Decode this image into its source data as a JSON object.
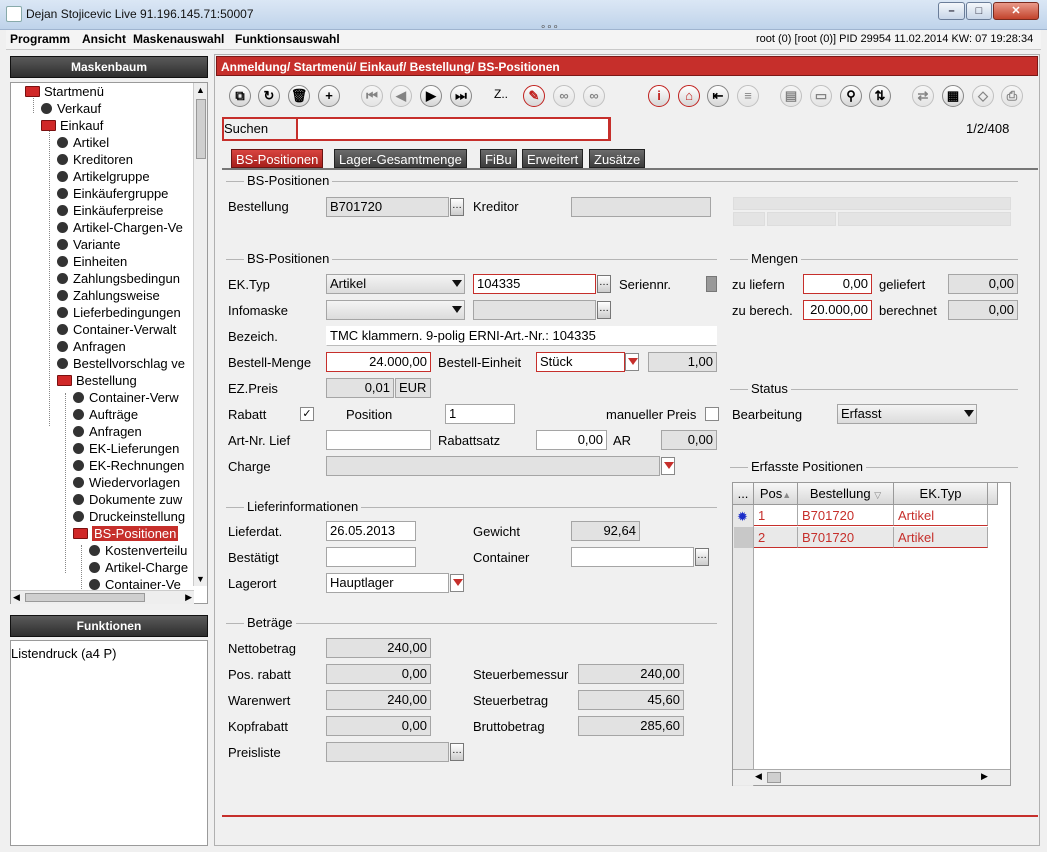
{
  "window": {
    "title": "Dejan Stojicevic Live 91.196.145.71:50007"
  },
  "menu": {
    "items": [
      "Programm",
      "Ansicht",
      "Maskenauswahl",
      "Funktionsauswahl"
    ],
    "status": "root (0) [root (0)] PID 29954   11.02.2014 KW: 07   19:28:34"
  },
  "tree": {
    "header": "Maskenbaum",
    "items": [
      {
        "label": "Startmenü",
        "icon": "folder-icon"
      },
      {
        "label": "Verkauf",
        "icon": "dot-icon"
      },
      {
        "label": "Einkauf",
        "icon": "folder-icon"
      },
      {
        "label": "Artikel",
        "icon": "dot-icon"
      },
      {
        "label": "Kreditoren",
        "icon": "dot-icon"
      },
      {
        "label": "Artikelgruppe",
        "icon": "dot-icon"
      },
      {
        "label": "Einkäufergruppe",
        "icon": "dot-icon"
      },
      {
        "label": "Einkäuferpreise",
        "icon": "dot-icon"
      },
      {
        "label": "Artikel-Chargen-Ve",
        "icon": "dot-icon"
      },
      {
        "label": "Variante",
        "icon": "dot-icon"
      },
      {
        "label": "Einheiten",
        "icon": "dot-icon"
      },
      {
        "label": "Zahlungsbedingun",
        "icon": "dot-icon"
      },
      {
        "label": "Zahlungsweise",
        "icon": "dot-icon"
      },
      {
        "label": "Lieferbedingungen",
        "icon": "dot-icon"
      },
      {
        "label": "Container-Verwalt",
        "icon": "dot-icon"
      },
      {
        "label": "Anfragen",
        "icon": "dot-icon"
      },
      {
        "label": "Bestellvorschlag ve",
        "icon": "dot-icon"
      },
      {
        "label": "Bestellung",
        "icon": "folder-icon"
      },
      {
        "label": "Container-Verw",
        "icon": "dot-icon"
      },
      {
        "label": "Aufträge",
        "icon": "dot-icon"
      },
      {
        "label": "Anfragen",
        "icon": "dot-icon"
      },
      {
        "label": "EK-Lieferungen",
        "icon": "dot-icon"
      },
      {
        "label": "EK-Rechnungen",
        "icon": "dot-icon"
      },
      {
        "label": "Wiedervorlagen",
        "icon": "dot-icon"
      },
      {
        "label": "Dokumente zuw",
        "icon": "dot-icon"
      },
      {
        "label": "Druckeinstellung",
        "icon": "dot-icon"
      },
      {
        "label": "BS-Positionen",
        "icon": "folder-icon"
      },
      {
        "label": "Kostenverteilu",
        "icon": "dot-icon"
      },
      {
        "label": "Artikel-Charge",
        "icon": "dot-icon"
      },
      {
        "label": "Container-Ve",
        "icon": "dot-icon"
      }
    ]
  },
  "functions": {
    "header": "Funktionen",
    "items": [
      "Listendruck (a4 P)"
    ]
  },
  "breadcrumb": "Anmeldung/ Startmenü/ Einkauf/ Bestellung/ BS-Positionen",
  "toolbar": {
    "z_label": "Z.."
  },
  "search": {
    "label": "Suchen",
    "value": "",
    "pager": "1/2/408"
  },
  "tabs": [
    "BS-Positionen",
    "Lager-Gesamtmenge",
    "FiBu",
    "Erweitert",
    "Zusätze"
  ],
  "head": {
    "group": "BS-Positionen",
    "bestellung_label": "Bestellung",
    "bestellung": "B701720",
    "kreditor_label": "Kreditor",
    "kreditor": ""
  },
  "pos": {
    "group": "BS-Positionen",
    "ektyp_label": "EK.Typ",
    "ektyp": "Artikel",
    "artnr": "104335",
    "seriennr_label": "Seriennr.",
    "infomaske_label": "Infomaske",
    "bezeich_label": "Bezeich.",
    "bezeich": "TMC klammern.  9-polig ERNI-Art.-Nr.: 104335",
    "bestellmenge_label": "Bestell-Menge",
    "bestellmenge": "24.000,00",
    "einheit_label": "Bestell-Einheit",
    "einheit": "Stück",
    "einheit_factor": "1,00",
    "ezpreis_label": "EZ.Preis",
    "ezpreis": "0,01",
    "currency": "EUR",
    "rabatt_label": "Rabatt",
    "rabatt_check": "✓",
    "position_label": "Position",
    "position": "1",
    "manpreis_label": "manueller Preis",
    "artnrlief_label": "Art-Nr. Lief",
    "rabattsatz_label": "Rabattsatz",
    "rabattsatz": "0,00",
    "ar_label": "AR",
    "ar": "0,00",
    "charge_label": "Charge"
  },
  "mengen": {
    "group": "Mengen",
    "zuliefern_label": "zu liefern",
    "zuliefern": "0,00",
    "geliefert_label": "geliefert",
    "geliefert": "0,00",
    "zuberech_label": "zu berech.",
    "zuberech": "20.000,00",
    "berechnet_label": "berechnet",
    "berechnet": "0,00"
  },
  "status": {
    "group": "Status",
    "bearbeitung_label": "Bearbeitung",
    "bearbeitung": "Erfasst"
  },
  "liefer": {
    "group": "Lieferinformationen",
    "lieferdat_label": "Lieferdat.",
    "lieferdat": "26.05.2013",
    "gewicht_label": "Gewicht",
    "gewicht": "92,64",
    "bestaetigt_label": "Bestätigt",
    "container_label": "Container",
    "lagerort_label": "Lagerort",
    "lagerort": "Hauptlager"
  },
  "betraege": {
    "group": "Beträge",
    "netto_label": "Nettobetrag",
    "netto": "240,00",
    "posrabatt_label": "Pos. rabatt",
    "posrabatt": "0,00",
    "steuerbem_label": "Steuerbemessur",
    "steuerbem": "240,00",
    "warenwert_label": "Warenwert",
    "warenwert": "240,00",
    "steuerbetrag_label": "Steuerbetrag",
    "steuerbetrag": "45,60",
    "kopfrabatt_label": "Kopfrabatt",
    "kopfrabatt": "0,00",
    "brutto_label": "Bruttobetrag",
    "brutto": "285,60",
    "preisliste_label": "Preisliste"
  },
  "erfasst": {
    "group": "Erfasste Positionen",
    "columns": [
      "...",
      "Pos",
      "Bestellung",
      "EK.Typ"
    ],
    "rows": [
      [
        "1",
        "B701720",
        "Artikel"
      ],
      [
        "2",
        "B701720",
        "Artikel"
      ]
    ]
  }
}
